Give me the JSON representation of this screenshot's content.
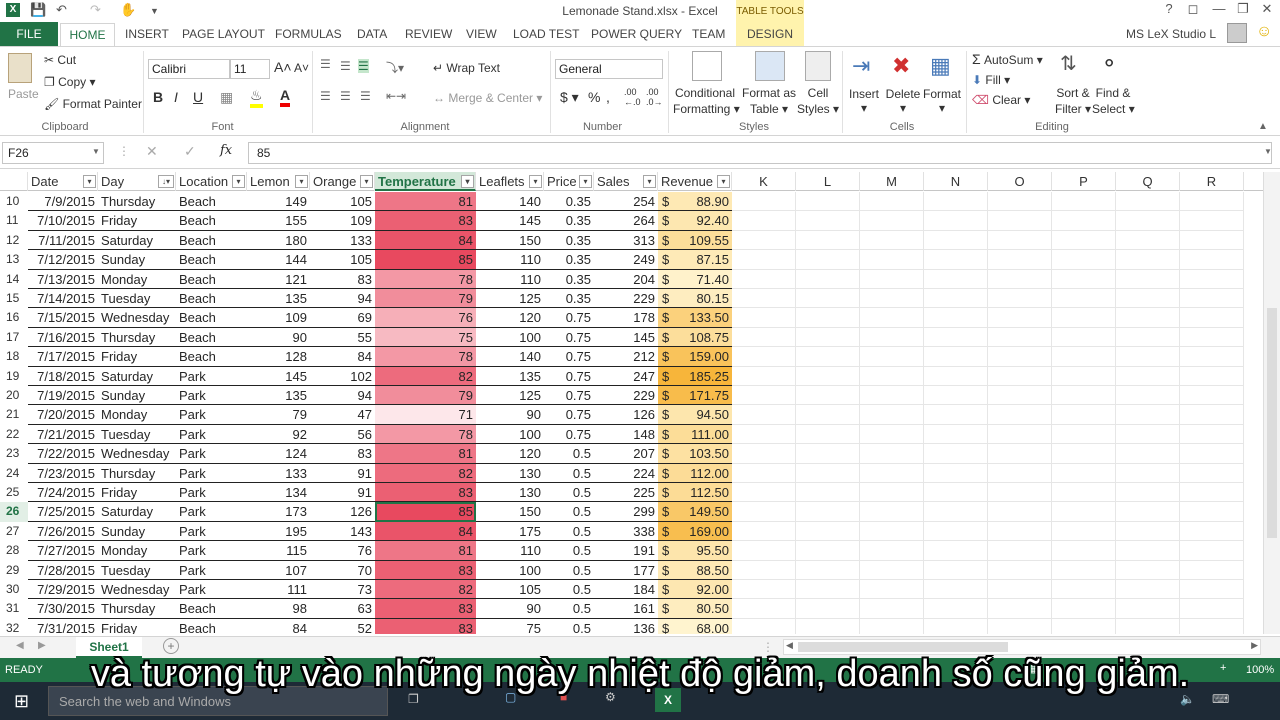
{
  "window": {
    "title": "Lemonade Stand.xlsx - Excel",
    "user": "MS LeX Studio L",
    "help": "?"
  },
  "tabs": {
    "file": "FILE",
    "items": [
      "HOME",
      "INSERT",
      "PAGE LAYOUT",
      "FORMULAS",
      "DATA",
      "REVIEW",
      "VIEW",
      "LOAD TEST",
      "POWER QUERY",
      "TEAM"
    ],
    "table_tools": "TABLE TOOLS",
    "design": "DESIGN"
  },
  "ribbon": {
    "paste": "Paste",
    "cut": "Cut",
    "copy": "Copy",
    "format_painter": "Format Painter",
    "clipboard": "Clipboard",
    "font_name": "Calibri",
    "font_size": "11",
    "font": "Font",
    "wrap_text": "Wrap Text",
    "merge_center": "Merge & Center",
    "alignment": "Alignment",
    "number_format": "General",
    "number": "Number",
    "conditional_formatting": [
      "Conditional",
      "Formatting"
    ],
    "format_as_table": [
      "Format as",
      "Table"
    ],
    "cell_styles": [
      "Cell",
      "Styles"
    ],
    "styles": "Styles",
    "insert": "Insert",
    "delete": "Delete",
    "format": "Format",
    "cells": "Cells",
    "autosum": "AutoSum",
    "fill": "Fill",
    "clear": "Clear",
    "sort_filter": [
      "Sort &",
      "Filter"
    ],
    "find_select": [
      "Find &",
      "Select"
    ],
    "editing": "Editing"
  },
  "formula_bar": {
    "name_box": "F26",
    "formula": "85"
  },
  "columns": {
    "headers": [
      "Date",
      "Day",
      "Location",
      "Lemon",
      "Orange",
      "Temperature",
      "Leaflets",
      "Price",
      "Sales",
      "Revenue"
    ],
    "empty_letters": [
      "K",
      "L",
      "M",
      "N",
      "O",
      "P",
      "Q",
      "R"
    ]
  },
  "rows": [
    {
      "n": "10",
      "date": "7/9/2015",
      "day": "Thursday",
      "loc": "Beach",
      "lemon": "149",
      "orange": "105",
      "temp": "81",
      "leaf": "140",
      "price": "0.35",
      "sales": "254",
      "rev": "88.90"
    },
    {
      "n": "11",
      "date": "7/10/2015",
      "day": "Friday",
      "loc": "Beach",
      "lemon": "155",
      "orange": "109",
      "temp": "83",
      "leaf": "145",
      "price": "0.35",
      "sales": "264",
      "rev": "92.40"
    },
    {
      "n": "12",
      "date": "7/11/2015",
      "day": "Saturday",
      "loc": "Beach",
      "lemon": "180",
      "orange": "133",
      "temp": "84",
      "leaf": "150",
      "price": "0.35",
      "sales": "313",
      "rev": "109.55"
    },
    {
      "n": "13",
      "date": "7/12/2015",
      "day": "Sunday",
      "loc": "Beach",
      "lemon": "144",
      "orange": "105",
      "temp": "85",
      "leaf": "110",
      "price": "0.35",
      "sales": "249",
      "rev": "87.15"
    },
    {
      "n": "14",
      "date": "7/13/2015",
      "day": "Monday",
      "loc": "Beach",
      "lemon": "121",
      "orange": "83",
      "temp": "78",
      "leaf": "110",
      "price": "0.35",
      "sales": "204",
      "rev": "71.40"
    },
    {
      "n": "15",
      "date": "7/14/2015",
      "day": "Tuesday",
      "loc": "Beach",
      "lemon": "135",
      "orange": "94",
      "temp": "79",
      "leaf": "125",
      "price": "0.35",
      "sales": "229",
      "rev": "80.15"
    },
    {
      "n": "16",
      "date": "7/15/2015",
      "day": "Wednesday",
      "loc": "Beach",
      "lemon": "109",
      "orange": "69",
      "temp": "76",
      "leaf": "120",
      "price": "0.75",
      "sales": "178",
      "rev": "133.50"
    },
    {
      "n": "17",
      "date": "7/16/2015",
      "day": "Thursday",
      "loc": "Beach",
      "lemon": "90",
      "orange": "55",
      "temp": "75",
      "leaf": "100",
      "price": "0.75",
      "sales": "145",
      "rev": "108.75"
    },
    {
      "n": "18",
      "date": "7/17/2015",
      "day": "Friday",
      "loc": "Beach",
      "lemon": "128",
      "orange": "84",
      "temp": "78",
      "leaf": "140",
      "price": "0.75",
      "sales": "212",
      "rev": "159.00"
    },
    {
      "n": "19",
      "date": "7/18/2015",
      "day": "Saturday",
      "loc": "Park",
      "lemon": "145",
      "orange": "102",
      "temp": "82",
      "leaf": "135",
      "price": "0.75",
      "sales": "247",
      "rev": "185.25"
    },
    {
      "n": "20",
      "date": "7/19/2015",
      "day": "Sunday",
      "loc": "Park",
      "lemon": "135",
      "orange": "94",
      "temp": "79",
      "leaf": "125",
      "price": "0.75",
      "sales": "229",
      "rev": "171.75"
    },
    {
      "n": "21",
      "date": "7/20/2015",
      "day": "Monday",
      "loc": "Park",
      "lemon": "79",
      "orange": "47",
      "temp": "71",
      "leaf": "90",
      "price": "0.75",
      "sales": "126",
      "rev": "94.50"
    },
    {
      "n": "22",
      "date": "7/21/2015",
      "day": "Tuesday",
      "loc": "Park",
      "lemon": "92",
      "orange": "56",
      "temp": "78",
      "leaf": "100",
      "price": "0.75",
      "sales": "148",
      "rev": "111.00"
    },
    {
      "n": "23",
      "date": "7/22/2015",
      "day": "Wednesday",
      "loc": "Park",
      "lemon": "124",
      "orange": "83",
      "temp": "81",
      "leaf": "120",
      "price": "0.5",
      "sales": "207",
      "rev": "103.50"
    },
    {
      "n": "24",
      "date": "7/23/2015",
      "day": "Thursday",
      "loc": "Park",
      "lemon": "133",
      "orange": "91",
      "temp": "82",
      "leaf": "130",
      "price": "0.5",
      "sales": "224",
      "rev": "112.00"
    },
    {
      "n": "25",
      "date": "7/24/2015",
      "day": "Friday",
      "loc": "Park",
      "lemon": "134",
      "orange": "91",
      "temp": "83",
      "leaf": "130",
      "price": "0.5",
      "sales": "225",
      "rev": "112.50"
    },
    {
      "n": "26",
      "date": "7/25/2015",
      "day": "Saturday",
      "loc": "Park",
      "lemon": "173",
      "orange": "126",
      "temp": "85",
      "leaf": "150",
      "price": "0.5",
      "sales": "299",
      "rev": "149.50"
    },
    {
      "n": "27",
      "date": "7/26/2015",
      "day": "Sunday",
      "loc": "Park",
      "lemon": "195",
      "orange": "143",
      "temp": "84",
      "leaf": "175",
      "price": "0.5",
      "sales": "338",
      "rev": "169.00"
    },
    {
      "n": "28",
      "date": "7/27/2015",
      "day": "Monday",
      "loc": "Park",
      "lemon": "115",
      "orange": "76",
      "temp": "81",
      "leaf": "110",
      "price": "0.5",
      "sales": "191",
      "rev": "95.50"
    },
    {
      "n": "29",
      "date": "7/28/2015",
      "day": "Tuesday",
      "loc": "Park",
      "lemon": "107",
      "orange": "70",
      "temp": "83",
      "leaf": "100",
      "price": "0.5",
      "sales": "177",
      "rev": "88.50"
    },
    {
      "n": "30",
      "date": "7/29/2015",
      "day": "Wednesday",
      "loc": "Park",
      "lemon": "111",
      "orange": "73",
      "temp": "82",
      "leaf": "105",
      "price": "0.5",
      "sales": "184",
      "rev": "92.00"
    },
    {
      "n": "31",
      "date": "7/30/2015",
      "day": "Thursday",
      "loc": "Beach",
      "lemon": "98",
      "orange": "63",
      "temp": "83",
      "leaf": "90",
      "price": "0.5",
      "sales": "161",
      "rev": "80.50"
    },
    {
      "n": "32",
      "date": "7/31/2015",
      "day": "Friday",
      "loc": "Beach",
      "lemon": "84",
      "orange": "52",
      "temp": "83",
      "leaf": "75",
      "price": "0.5",
      "sales": "136",
      "rev": "68.00"
    }
  ],
  "currency_symbol": "$",
  "selected_row": "26",
  "colors": {
    "excel_green": "#217346",
    "temp_low": "#fde7ea",
    "temp_high": "#e8495f",
    "rev_low": "#fff4cf",
    "rev_high": "#f7b53a"
  },
  "sheet_tab": "Sheet1",
  "status": {
    "ready": "READY",
    "zoom": "100%"
  },
  "taskbar": {
    "search_placeholder": "Search the web and Windows"
  },
  "subtitle": "và tương tự vào những ngày nhiệt độ giảm, doanh số cũng giảm."
}
